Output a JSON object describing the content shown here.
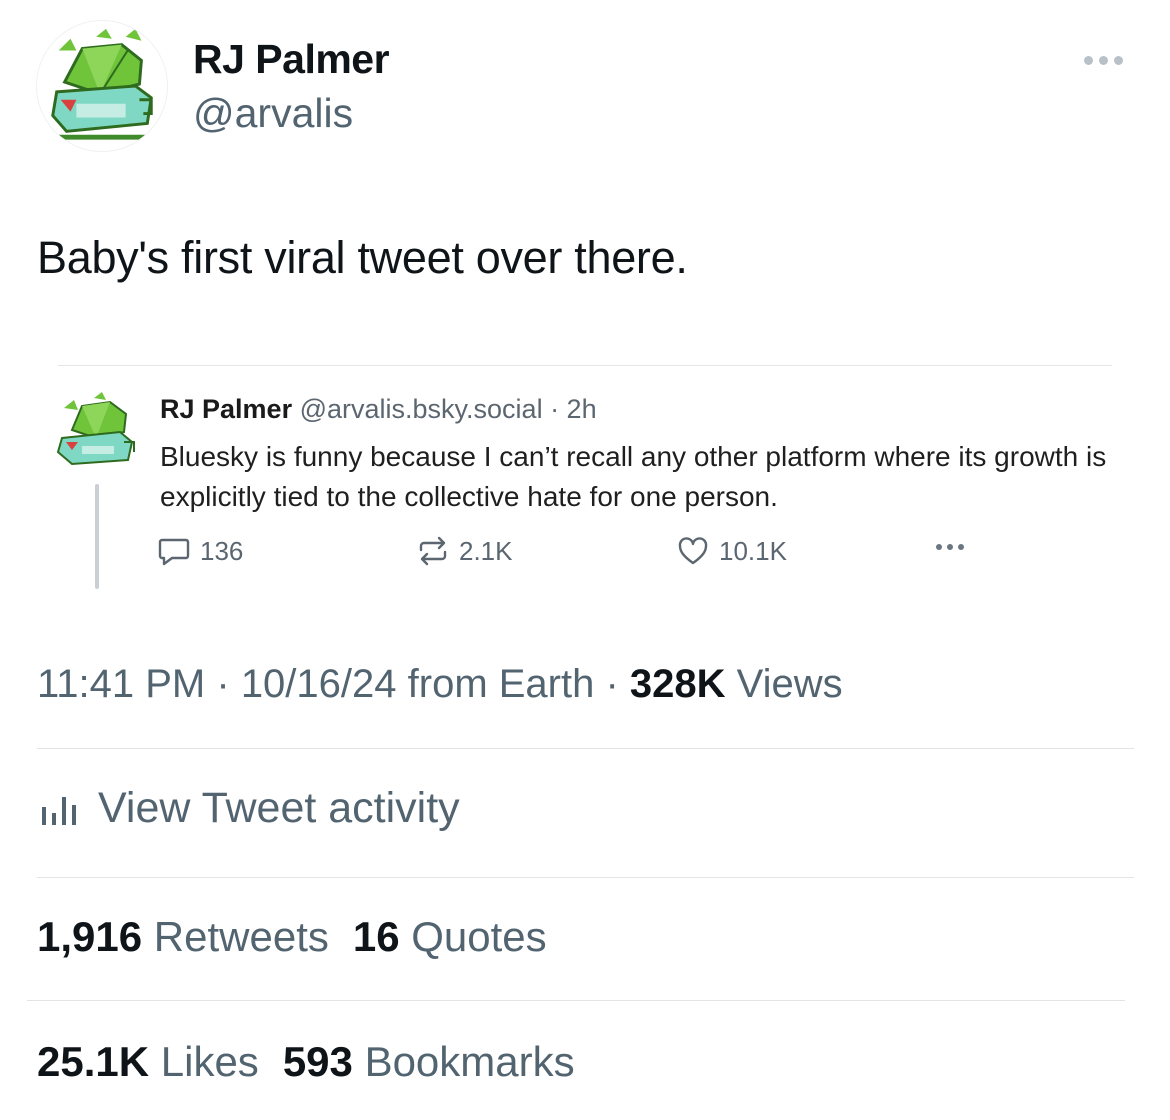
{
  "author": {
    "name": "RJ Palmer",
    "handle": "@arvalis"
  },
  "tweet": {
    "text": "Baby's first viral tweet over there."
  },
  "quoted_post": {
    "name": "RJ Palmer",
    "meta": "@arvalis.bsky.social · 2h",
    "text": "Bluesky is funny because I can’t recall any other platform where its growth is explicitly tied to the collective hate for one person.",
    "replies": "136",
    "reposts": "2.1K",
    "likes": "10.1K"
  },
  "meta": {
    "time": "11:41 PM",
    "date": "10/16/24",
    "source": "from Earth",
    "views_count": "328K",
    "views_label": "Views"
  },
  "activity": {
    "label": "View Tweet activity"
  },
  "stats": {
    "retweets_count": "1,916",
    "retweets_label": "Retweets",
    "quotes_count": "16",
    "quotes_label": "Quotes",
    "likes_count": "25.1K",
    "likes_label": "Likes",
    "bookmarks_count": "593",
    "bookmarks_label": "Bookmarks"
  },
  "colors": {
    "text_primary": "#0f1419",
    "text_secondary": "#536471",
    "divider": "#e1e5e8",
    "avatar_green": "#6fc43a",
    "avatar_teal": "#7fd8c4"
  },
  "icons": [
    "overflow-menu-icon",
    "reply-icon",
    "repost-icon",
    "like-icon",
    "analytics-bars-icon"
  ]
}
